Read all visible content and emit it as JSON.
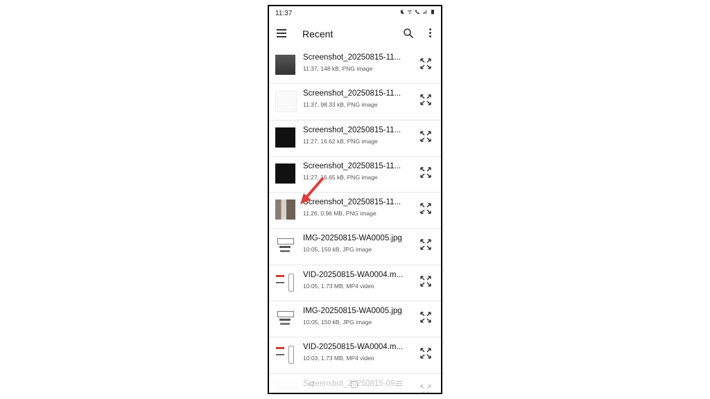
{
  "status_bar": {
    "time": "11:37"
  },
  "app_bar": {
    "title": "Recent",
    "icons": [
      "menu-icon",
      "search-icon",
      "more-vert-icon"
    ]
  },
  "files": [
    {
      "name": "Screenshot_20250815-11...",
      "meta": "11:37, 148 kB, PNG image",
      "thumb": "screen-a"
    },
    {
      "name": "Screenshot_20250815-11...",
      "meta": "11:37, 98.33 kB, PNG image",
      "thumb": "screen-b"
    },
    {
      "name": "Screenshot_20250815-11...",
      "meta": "11:27, 16.62 kB, PNG image",
      "thumb": "dark"
    },
    {
      "name": "Screenshot_20250815-11...",
      "meta": "11:27, 16.65 kB, PNG image",
      "thumb": "dark"
    },
    {
      "name": "Screenshot_20250815-11...",
      "meta": "11:26, 0.96 MB, PNG image",
      "thumb": "photo"
    },
    {
      "name": "IMG-20250815-WA0005.jpg",
      "meta": "10:05, 150 kB, JPG image",
      "thumb": "doc"
    },
    {
      "name": "VID-20250815-WA0004.m...",
      "meta": "10:05, 1.73 MB, MP4 video",
      "thumb": "vid"
    },
    {
      "name": "IMG-20250815-WA0005.jpg",
      "meta": "10:05, 150 kB, JPG image",
      "thumb": "doc"
    },
    {
      "name": "VID-20250815-WA0004.m...",
      "meta": "10:03, 1.73 MB, MP4 video",
      "thumb": "vid"
    },
    {
      "name": "Screenshot_20250815-09...",
      "meta": "",
      "thumb": "screen-b"
    }
  ],
  "colors": {
    "annotation_arrow": "#e53935",
    "divider": "#e6e6e6"
  }
}
